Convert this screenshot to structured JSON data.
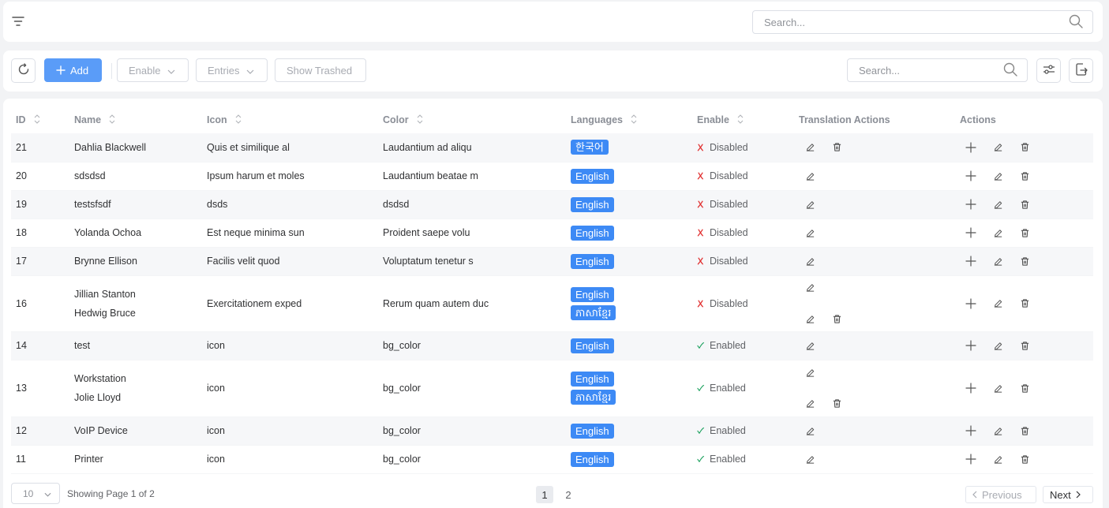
{
  "topbar": {
    "search_placeholder": "Search..."
  },
  "toolbar": {
    "add_label": "Add",
    "enable_label": "Enable",
    "entries_label": "Entries",
    "trashed_label": "Show Trashed",
    "search_placeholder": "Search..."
  },
  "table": {
    "headers": {
      "id": "ID",
      "name": "Name",
      "icon": "Icon",
      "color": "Color",
      "languages": "Languages",
      "enable": "Enable",
      "translation_actions": "Translation Actions",
      "actions": "Actions"
    },
    "rows": [
      {
        "id": "21",
        "names": [
          "Dahlia Blackwell"
        ],
        "icon": "Quis et similique al",
        "color": "Laudantium ad aliqu",
        "languages": [
          "한국어"
        ],
        "status": "Disabled",
        "enabled": false
      },
      {
        "id": "20",
        "names": [
          "sdsdsd"
        ],
        "icon": "Ipsum harum et moles",
        "color": "Laudantium beatae m",
        "languages": [
          "English"
        ],
        "status": "Disabled",
        "enabled": false
      },
      {
        "id": "19",
        "names": [
          "testsfsdf"
        ],
        "icon": "dsds",
        "color": "dsdsd",
        "languages": [
          "English"
        ],
        "status": "Disabled",
        "enabled": false
      },
      {
        "id": "18",
        "names": [
          "Yolanda Ochoa"
        ],
        "icon": "Est neque minima sun",
        "color": "Proident saepe volu",
        "languages": [
          "English"
        ],
        "status": "Disabled",
        "enabled": false
      },
      {
        "id": "17",
        "names": [
          "Brynne Ellison"
        ],
        "icon": "Facilis velit quod",
        "color": "Voluptatum tenetur s",
        "languages": [
          "English"
        ],
        "status": "Disabled",
        "enabled": false
      },
      {
        "id": "16",
        "names": [
          "Jillian Stanton",
          "Hedwig Bruce"
        ],
        "icon": "Exercitationem exped",
        "color": "Rerum quam autem duc",
        "languages": [
          "English",
          "ភាសាខ្មែរ"
        ],
        "status": "Disabled",
        "enabled": false
      },
      {
        "id": "14",
        "names": [
          "test"
        ],
        "icon": "icon",
        "color": "bg_color",
        "languages": [
          "English"
        ],
        "status": "Enabled",
        "enabled": true
      },
      {
        "id": "13",
        "names": [
          "Workstation",
          "Jolie Lloyd"
        ],
        "icon": "icon",
        "color": "bg_color",
        "languages": [
          "English",
          "ភាសាខ្មែរ"
        ],
        "status": "Enabled",
        "enabled": true
      },
      {
        "id": "12",
        "names": [
          "VoIP Device"
        ],
        "icon": "icon",
        "color": "bg_color",
        "languages": [
          "English"
        ],
        "status": "Enabled",
        "enabled": true
      },
      {
        "id": "11",
        "names": [
          "Printer"
        ],
        "icon": "icon",
        "color": "bg_color",
        "languages": [
          "English"
        ],
        "status": "Enabled",
        "enabled": true
      }
    ]
  },
  "footer": {
    "page_size": "10",
    "showing": "Showing Page 1 of 2",
    "pages": [
      "1",
      "2"
    ],
    "previous_label": "Previous",
    "next_label": "Next"
  },
  "colors": {
    "primary": "#5a9cf8",
    "language_badge": "#3d8af5",
    "disabled_x": "#e02b2b",
    "enabled_check": "#19a05c"
  }
}
